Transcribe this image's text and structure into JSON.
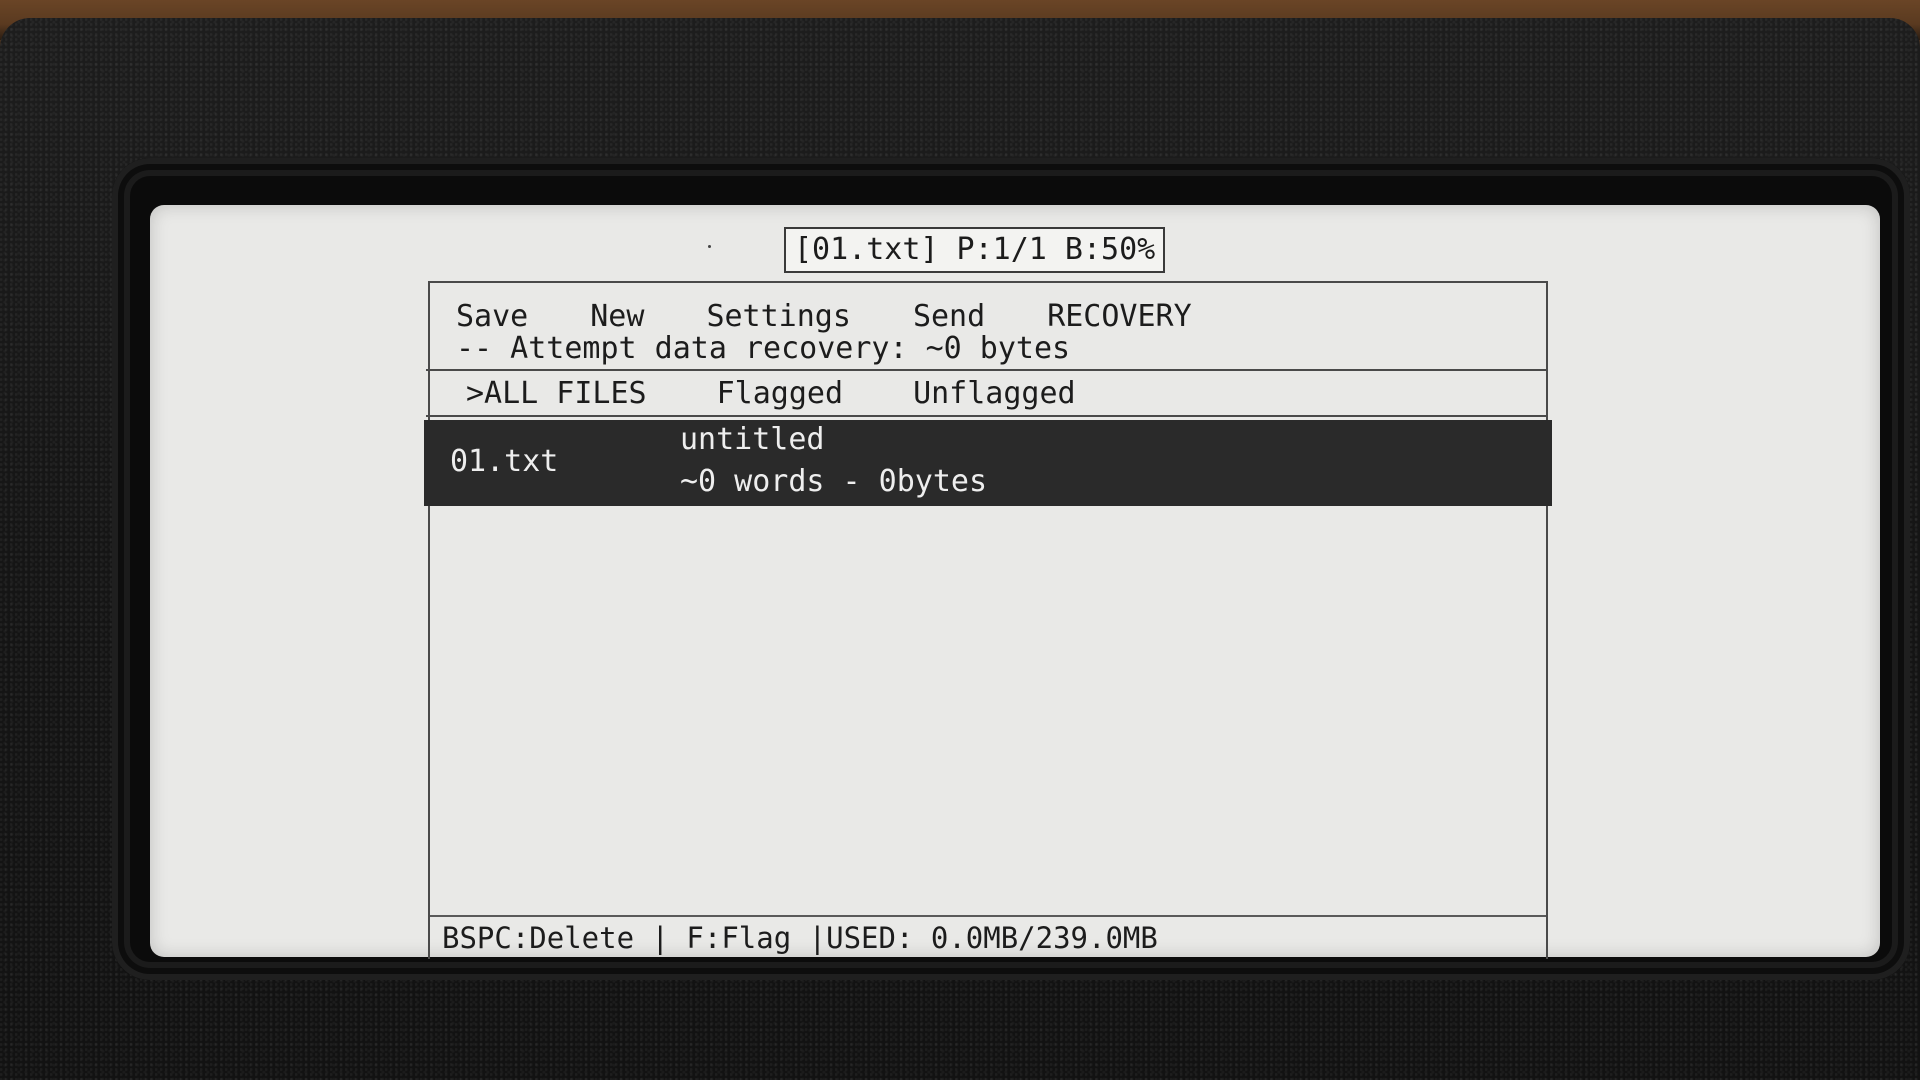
{
  "titlebar": {
    "text": "[01.txt] P:1/1 B:50%"
  },
  "menu": {
    "items": [
      {
        "label": "Save"
      },
      {
        "label": "New"
      },
      {
        "label": "Settings"
      },
      {
        "label": "Send"
      },
      {
        "label": "RECOVERY"
      }
    ],
    "recovery_text": "-- Attempt data recovery: ~0 bytes"
  },
  "filters": {
    "tabs": [
      {
        "label": ">ALL FILES"
      },
      {
        "label": "Flagged"
      },
      {
        "label": "Unflagged"
      }
    ]
  },
  "files": [
    {
      "name": "01.txt",
      "title": "untitled",
      "meta": "~0 words - 0bytes"
    }
  ],
  "footer": {
    "text": "BSPC:Delete | F:Flag |USED: 0.0MB/239.0MB"
  },
  "colors": {
    "screen": "#e9e9e7",
    "selected_row": "#2a2a2a",
    "bezel": "#151515"
  }
}
